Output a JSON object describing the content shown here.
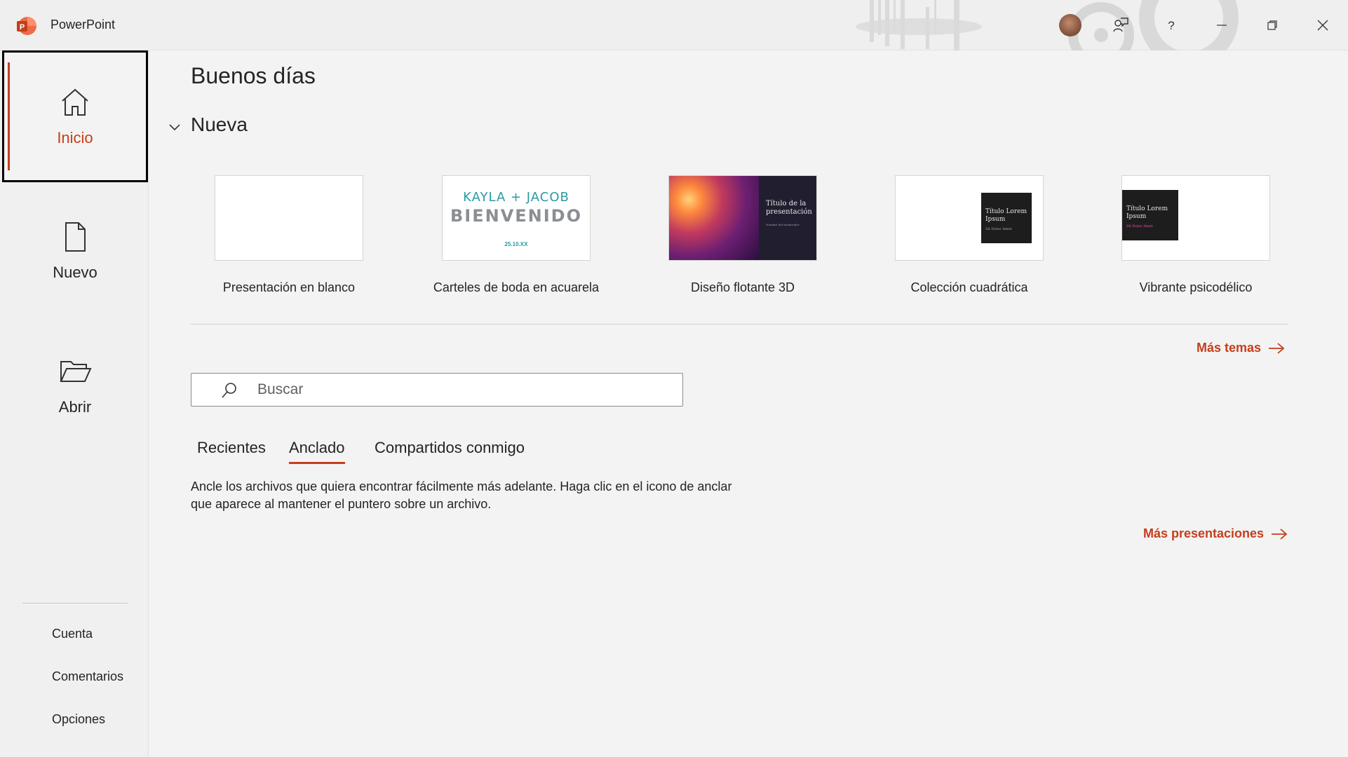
{
  "app": {
    "title": "PowerPoint"
  },
  "sidebar": {
    "items": [
      {
        "label": "Inicio",
        "icon": "home-icon"
      },
      {
        "label": "Nuevo",
        "icon": "new-file-icon"
      },
      {
        "label": "Abrir",
        "icon": "folder-open-icon"
      }
    ],
    "bottom": [
      {
        "label": "Cuenta"
      },
      {
        "label": "Comentarios"
      },
      {
        "label": "Opciones"
      }
    ]
  },
  "main": {
    "greeting": "Buenos días",
    "section_title": "Nueva",
    "templates": [
      {
        "label": "Presentación en blanco"
      },
      {
        "label": "Carteles de boda en acuarela",
        "thumb_names": "KAYLA + JACOB",
        "thumb_title": "BIENVENIDO",
        "thumb_date": "25.10.XX"
      },
      {
        "label": "Diseño flotante 3D",
        "thumb_title": "Título de la presentación",
        "thumb_sub": "Nombre del moderador"
      },
      {
        "label": "Colección cuadrática",
        "thumb_title": "Título Lorem Ipsum",
        "thumb_sub": "Sit Dolor Amet"
      },
      {
        "label": "Vibrante psicodélico",
        "thumb_title": "Título Lorem Ipsum",
        "thumb_sub": "Sit Dolor Amet"
      }
    ],
    "more_themes": "Más temas",
    "search": {
      "placeholder": "Buscar",
      "value": ""
    },
    "tabs": [
      {
        "label": "Recientes"
      },
      {
        "label": "Anclado"
      },
      {
        "label": "Compartidos conmigo"
      }
    ],
    "pinned_message": "Ancle los archivos que quiera encontrar fácilmente más adelante. Haga clic en el icono de anclar que aparece al mantener el puntero sobre un archivo.",
    "more_presentations": "Más presentaciones"
  },
  "colors": {
    "accent": "#c43e1c",
    "background": "#f3f3f3"
  }
}
